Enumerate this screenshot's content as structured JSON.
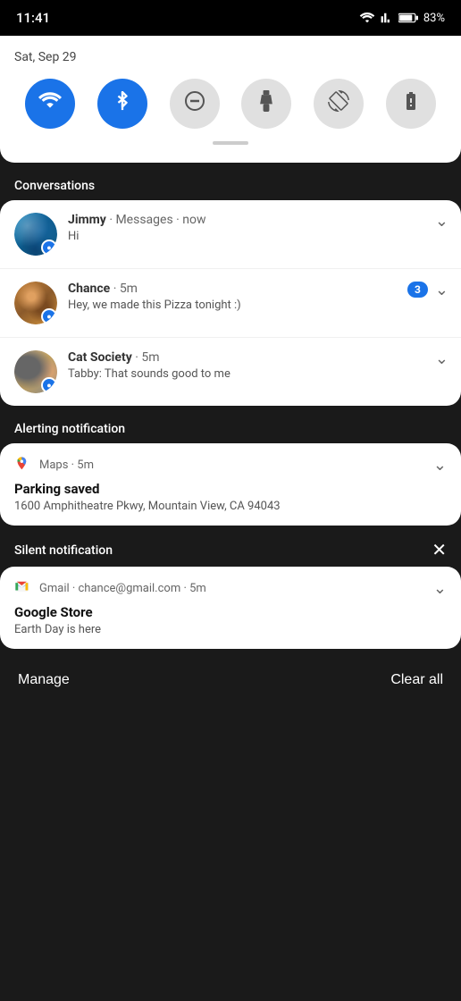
{
  "statusBar": {
    "time": "11:41",
    "battery": "83%"
  },
  "quickSettings": {
    "date": "Sat, Sep 29",
    "toggles": [
      {
        "id": "wifi",
        "label": "Wi-Fi",
        "active": true,
        "icon": "wifi"
      },
      {
        "id": "bluetooth",
        "label": "Bluetooth",
        "active": true,
        "icon": "bluetooth"
      },
      {
        "id": "doNotDisturb",
        "label": "Do Not Disturb",
        "active": false,
        "icon": "dnd"
      },
      {
        "id": "flashlight",
        "label": "Flashlight",
        "active": false,
        "icon": "flashlight"
      },
      {
        "id": "autoRotate",
        "label": "Auto Rotate",
        "active": false,
        "icon": "rotate"
      },
      {
        "id": "batterySaver",
        "label": "Battery Saver",
        "active": false,
        "icon": "battery"
      }
    ]
  },
  "sections": {
    "conversations": {
      "label": "Conversations",
      "items": [
        {
          "id": "jimmy",
          "name": "Jimmy",
          "app": "Messages",
          "time": "now",
          "body": "Hi",
          "badge": null,
          "avatarType": "jimmy"
        },
        {
          "id": "chance",
          "name": "Chance",
          "app": null,
          "time": "5m",
          "body": "Hey, we made this Pizza tonight :)",
          "badge": "3",
          "avatarType": "chance"
        },
        {
          "id": "catSociety",
          "name": "Cat Society",
          "app": null,
          "time": "5m",
          "body": "Tabby: That sounds good to me",
          "badge": null,
          "avatarType": "cat"
        }
      ]
    },
    "alerting": {
      "label": "Alerting notification",
      "app": "Maps",
      "time": "5m",
      "title": "Parking saved",
      "body": "1600 Amphitheatre Pkwy, Mountain View, CA 94043"
    },
    "silent": {
      "label": "Silent notification",
      "app": "Gmail",
      "email": "chance@gmail.com",
      "time": "5m",
      "title": "Google Store",
      "body": "Earth Day is here"
    }
  },
  "bottomBar": {
    "manageLabel": "Manage",
    "clearAllLabel": "Clear all"
  }
}
